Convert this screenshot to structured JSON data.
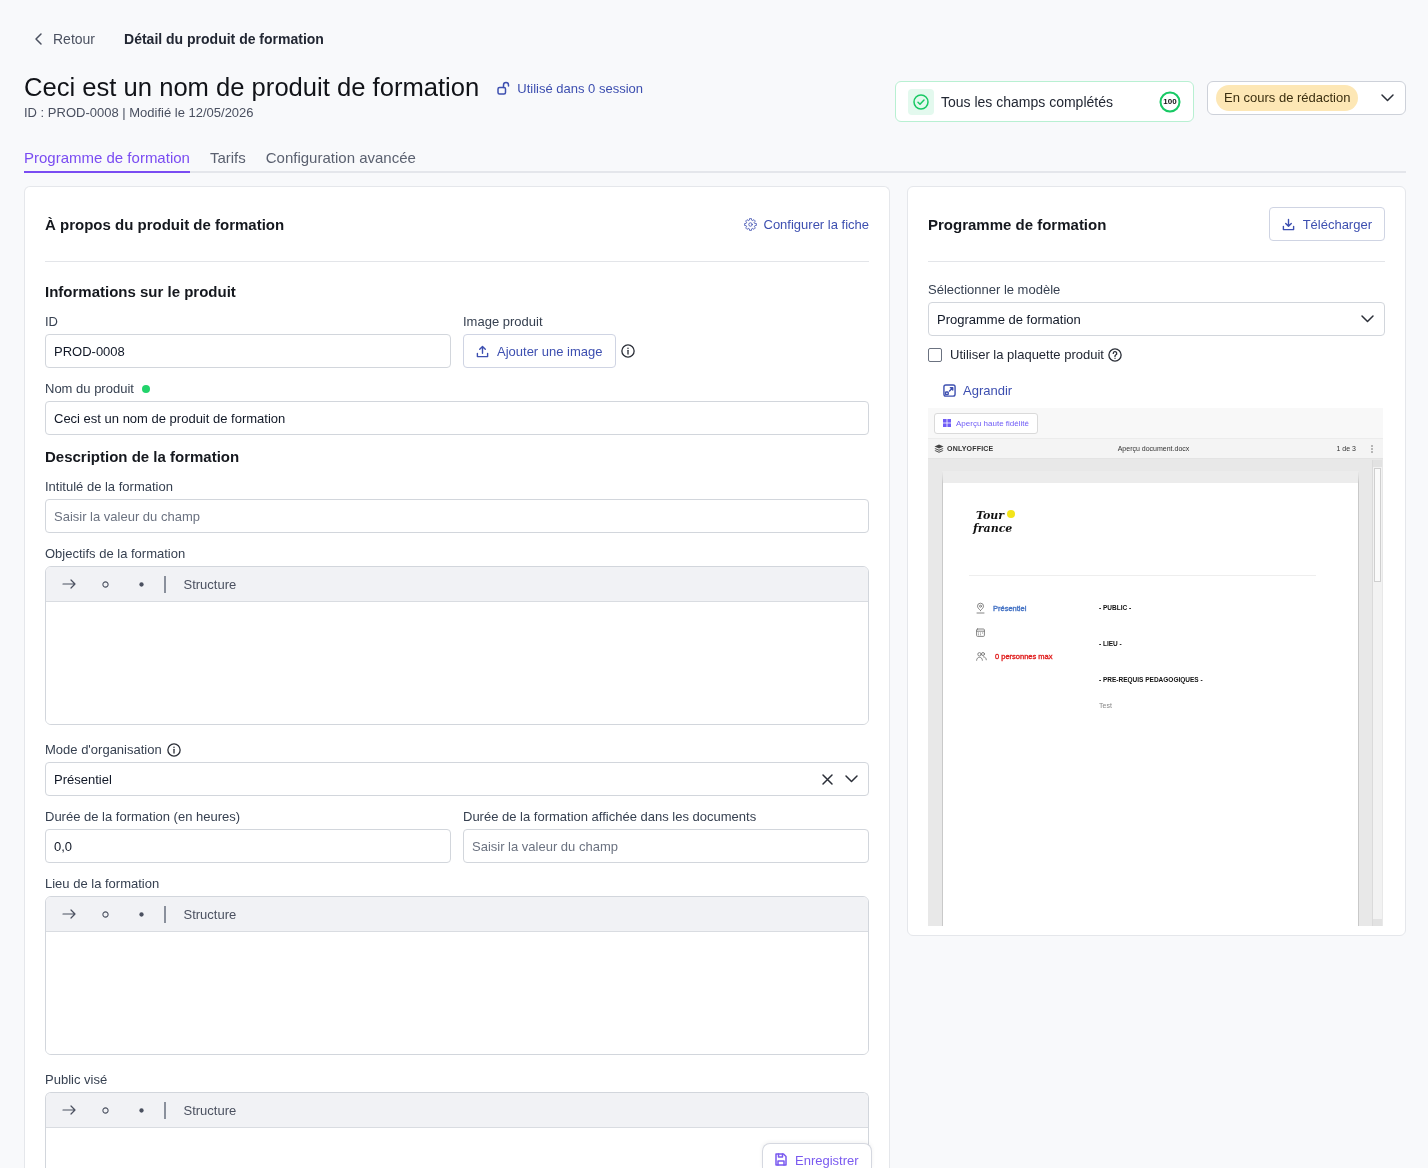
{
  "breadcrumb": {
    "back": "Retour",
    "current": "Détail du produit de formation"
  },
  "header": {
    "title": "Ceci est un nom de produit de formation",
    "usage_link": "Utilisé dans 0 session",
    "meta": "ID : PROD-0008 | Modifié le 12/05/2026"
  },
  "completeness": {
    "label": "Tous les champs complétés",
    "score": "100",
    "level": 1
  },
  "status": {
    "label": "En cours de rédaction"
  },
  "tabs": [
    {
      "label": "Programme de formation",
      "selected": true
    },
    {
      "label": "Tarifs",
      "selected": false
    },
    {
      "label": "Configuration avancée",
      "selected": false
    }
  ],
  "about_card": {
    "title": "À propos du produit de formation",
    "configure_link": "Configurer la fiche",
    "sections": [
      {
        "heading": "Informations sur le produit",
        "rows": [
          [
            {
              "kind": "input",
              "label": "ID",
              "value": "PROD-0008"
            },
            {
              "kind": "image",
              "label": "Image produit",
              "button": "Ajouter une image",
              "info": true
            }
          ],
          [
            {
              "kind": "input",
              "label": "Nom du produit",
              "status_dot": true,
              "value": "Ceci est un nom de produit de formation"
            }
          ]
        ]
      },
      {
        "heading": "Description de la formation",
        "rows": [
          [
            {
              "kind": "input",
              "label": "Intitulé de la formation",
              "placeholder": "Saisir la valeur du champ"
            }
          ],
          [
            {
              "kind": "editor",
              "label": "Objectifs de la formation",
              "toolbar_label": "Structure"
            }
          ],
          [
            {
              "kind": "select",
              "label": "Mode d'organisation",
              "info": true,
              "value": "Présentiel",
              "clearable": true
            }
          ],
          [
            {
              "kind": "input",
              "label": "Durée de la formation (en heures)",
              "value": "0,0"
            },
            {
              "kind": "input",
              "label": "Durée de la formation affichée dans les documents",
              "placeholder": "Saisir la valeur du champ"
            }
          ],
          [
            {
              "kind": "editor",
              "label": "Lieu de la formation",
              "toolbar_label": "Structure"
            }
          ],
          [
            {
              "kind": "editor",
              "label": "Public visé",
              "toolbar_label": "Structure"
            }
          ]
        ]
      }
    ]
  },
  "save_button": "Enregistrer",
  "program_card": {
    "title": "Programme de formation",
    "download_button": "Télécharger",
    "template": {
      "label": "Sélectionner le modèle",
      "value": "Programme de formation"
    },
    "brochure": {
      "label": "Utiliser la plaquette produit",
      "checked": false
    },
    "expand_link": "Agrandir",
    "preview": {
      "hifi_button": "Aperçu haute fidélité",
      "app_name": "ONLYOFFICE",
      "file_name": "Aperçu document.docx",
      "page_count": "1 de 3",
      "document": {
        "logo_lines": [
          "Tour",
          "france"
        ],
        "details": [
          {
            "kind": "location",
            "text": "Présentiel",
            "color": "#4472c4"
          },
          {
            "kind": "calendar"
          },
          {
            "kind": "people",
            "text": "0 personnes max",
            "color": "#e02020"
          }
        ],
        "sections": [
          {
            "heading": "- PUBLIC -"
          },
          {
            "heading": "- LIEU -"
          },
          {
            "heading": "- PRE-REQUIS PEDAGOGIQUES -",
            "body": "Test"
          }
        ]
      }
    }
  }
}
